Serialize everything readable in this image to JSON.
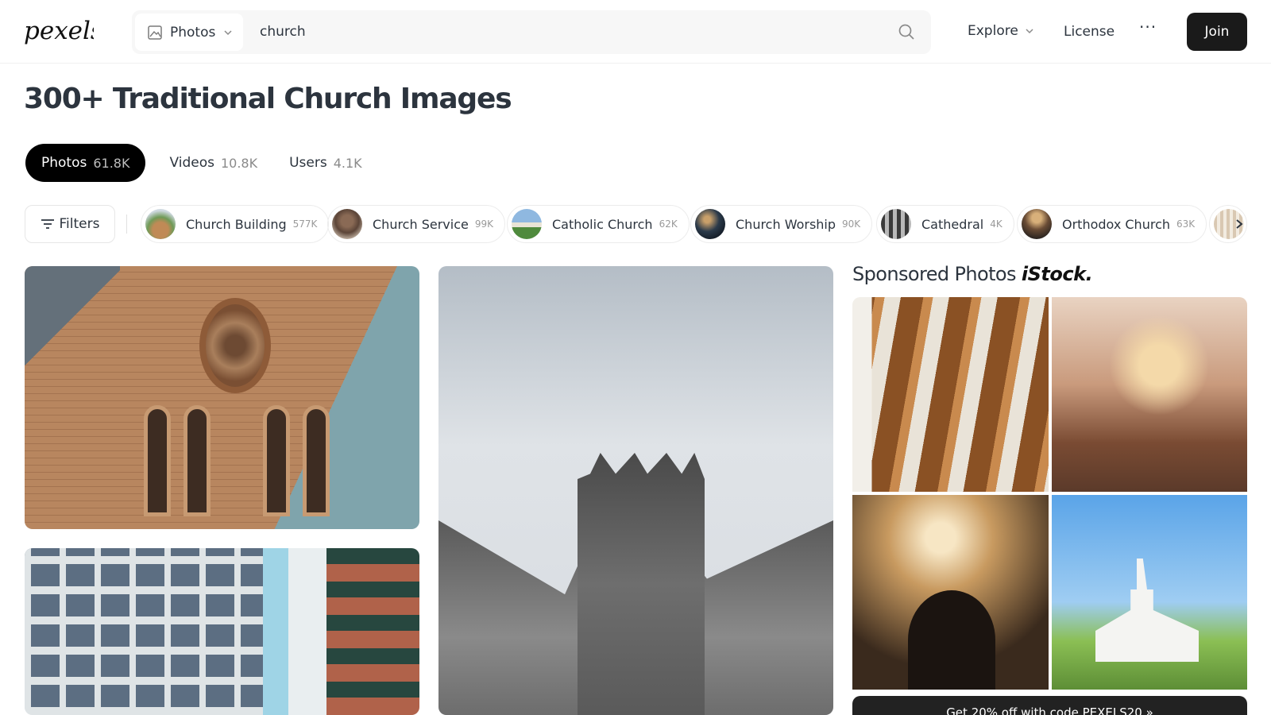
{
  "header": {
    "logo_text": "pexels",
    "search_type": "Photos",
    "search_query": "church",
    "nav_explore": "Explore",
    "nav_license": "License",
    "nav_more": "···",
    "join_label": "Join"
  },
  "page_title": "300+ Traditional Church Images",
  "tabs": [
    {
      "label": "Photos",
      "count": "61.8K",
      "active": true
    },
    {
      "label": "Videos",
      "count": "10.8K",
      "active": false
    },
    {
      "label": "Users",
      "count": "4.1K",
      "active": false
    }
  ],
  "filters_label": "Filters",
  "chips": [
    {
      "label": "Church Building",
      "count": "577K"
    },
    {
      "label": "Church Service",
      "count": "99K"
    },
    {
      "label": "Catholic Church",
      "count": "62K"
    },
    {
      "label": "Church Worship",
      "count": "90K"
    },
    {
      "label": "Cathedral",
      "count": "4K"
    },
    {
      "label": "Orthodox Church",
      "count": "63K"
    }
  ],
  "sponsored": {
    "title": "Sponsored Photos",
    "brand": "iStock.",
    "promo": "Get 20% off with code PEXELS20 »"
  },
  "colors": {
    "accent": "#000000",
    "text": "#2c343e",
    "muted": "#8a8a8a"
  }
}
